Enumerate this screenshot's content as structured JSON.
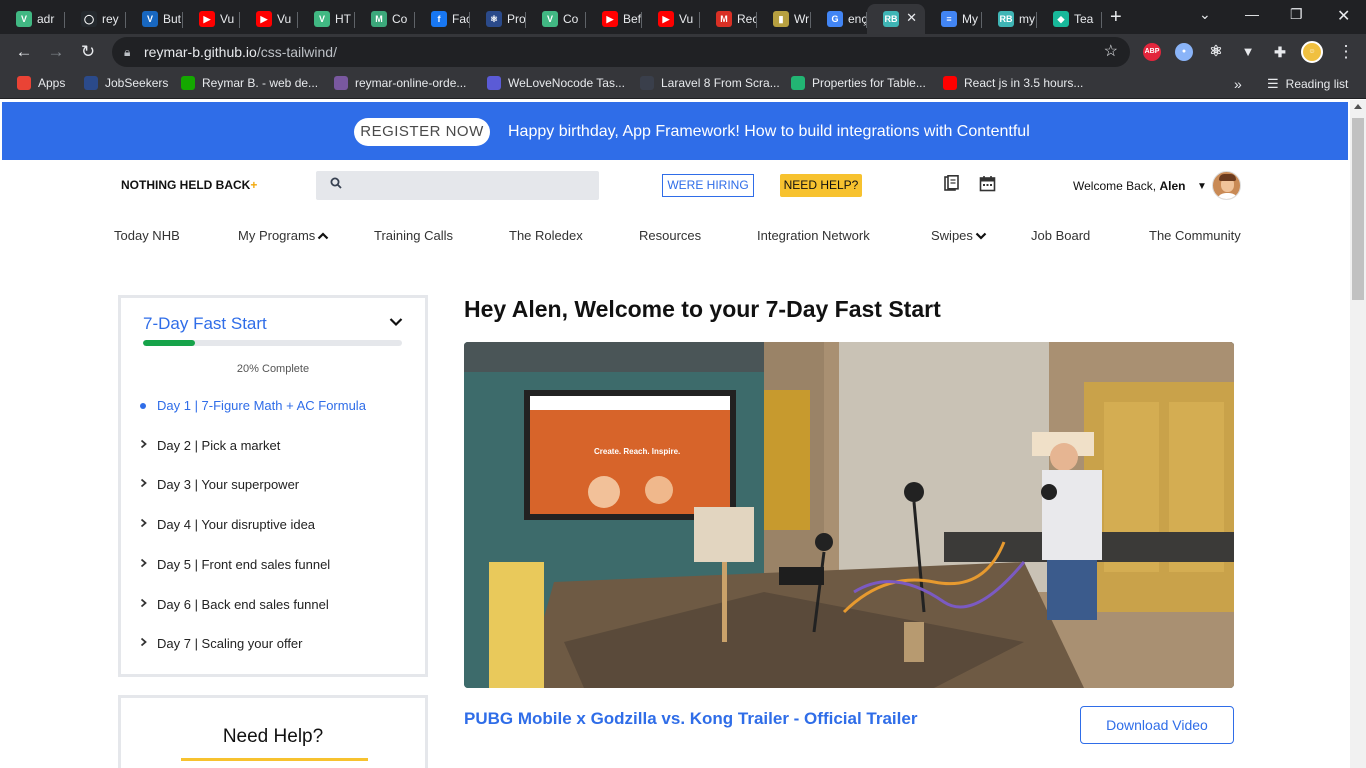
{
  "browser": {
    "tabs": [
      {
        "title": "adr",
        "favicon": "vue-icon",
        "color": "#41b883",
        "glyph": "V"
      },
      {
        "title": "rey",
        "favicon": "github-icon",
        "color": "#24292e",
        "glyph": "◯"
      },
      {
        "title": "But",
        "favicon": "vuetify-icon",
        "color": "#1867c0",
        "glyph": "V"
      },
      {
        "title": "Vu",
        "favicon": "youtube-icon",
        "color": "#ff0000",
        "glyph": "▶"
      },
      {
        "title": "Vu",
        "favicon": "youtube-icon",
        "color": "#ff0000",
        "glyph": "▶"
      },
      {
        "title": "HT",
        "favicon": "vue-icon",
        "color": "#41b883",
        "glyph": "V"
      },
      {
        "title": "Co",
        "favicon": "mdn-icon",
        "color": "#3ca87b",
        "glyph": "M"
      },
      {
        "title": "Fac",
        "favicon": "facebook-icon",
        "color": "#1877f2",
        "glyph": "f"
      },
      {
        "title": "Pro",
        "favicon": "react-icon",
        "color": "#2b4a8a",
        "glyph": "⚛"
      },
      {
        "title": "Co",
        "favicon": "vue-icon",
        "color": "#41b883",
        "glyph": "V"
      },
      {
        "title": "Bef",
        "favicon": "youtube-icon",
        "color": "#ff0000",
        "glyph": "▶"
      },
      {
        "title": "Vu",
        "favicon": "youtube-icon",
        "color": "#ff0000",
        "glyph": "▶"
      },
      {
        "title": "Rec",
        "favicon": "gmail-icon",
        "color": "#d93025",
        "glyph": "M"
      },
      {
        "title": "Wr",
        "favicon": "writing-icon",
        "color": "#b7a040",
        "glyph": "▮"
      },
      {
        "title": "enç",
        "favicon": "google-icon",
        "color": "#4285f4",
        "glyph": "G"
      },
      {
        "title": "",
        "favicon": "rb-icon",
        "color": "#3fb5b5",
        "glyph": "RB",
        "active": true
      },
      {
        "title": "My",
        "favicon": "docs-icon",
        "color": "#4285f4",
        "glyph": "≡"
      },
      {
        "title": "my",
        "favicon": "rb-icon",
        "color": "#3fb5b5",
        "glyph": "RB"
      },
      {
        "title": "Tea",
        "favicon": "diamond-icon",
        "color": "#18b89a",
        "glyph": "◆"
      }
    ],
    "url_host": "reymar-b.github.io",
    "url_path": "/css-tailwind/",
    "bookmarks": [
      {
        "label": "Apps",
        "icon": "apps-grid-icon",
        "color": "#ea4335"
      },
      {
        "label": "JobSeekers",
        "icon": "jobseekers-icon",
        "color": "#2b4a8a"
      },
      {
        "label": "Reymar B. - web de...",
        "icon": "upwork-icon",
        "color": "#14a800"
      },
      {
        "label": "reymar-online-orde...",
        "icon": "heroku-icon",
        "color": "#79589f"
      },
      {
        "label": "WeLoveNocode Tas...",
        "icon": "tasks-icon",
        "color": "#5b5bd6"
      },
      {
        "label": "Laravel 8 From Scra...",
        "icon": "laracasts-icon",
        "color": "#3a3f4b"
      },
      {
        "label": "Properties for Table...",
        "icon": "tailwind-icon",
        "color": "#22b573"
      },
      {
        "label": "React js in 3.5 hours...",
        "icon": "youtube-icon",
        "color": "#ff0000"
      }
    ],
    "reading_list": "Reading list"
  },
  "banner": {
    "button": "REGISTER NOW",
    "message": "Happy birthday, App Framework! How to build integrations with Contentful"
  },
  "header": {
    "logo": "NOTHING HELD BACK",
    "logo_plus": "+",
    "hiring": "WERE HIRING",
    "help": "NEED HELP?",
    "welcome": "Welcome Back,",
    "user": "Alen"
  },
  "nav": [
    {
      "label": "Today NHB"
    },
    {
      "label": "My Programs",
      "chevron": "up"
    },
    {
      "label": "Training Calls"
    },
    {
      "label": "The Roledex"
    },
    {
      "label": "Resources"
    },
    {
      "label": "Integration Network"
    },
    {
      "label": "Swipes",
      "chevron": "down"
    },
    {
      "label": "Job Board"
    },
    {
      "label": "The Community"
    }
  ],
  "course": {
    "title": "7-Day Fast Start",
    "progress": 0.2,
    "progress_label": "20% Complete",
    "lessons": [
      {
        "label": "Day 1 | 7-Figure Math + AC Formula",
        "active": true
      },
      {
        "label": "Day 2 | Pick a market"
      },
      {
        "label": "Day 3 | Your superpower"
      },
      {
        "label": "Day 4 | Your disruptive idea"
      },
      {
        "label": "Day 5 | Front end sales funnel"
      },
      {
        "label": "Day 6 | Back end sales funnel"
      },
      {
        "label": "Day 7 | Scaling your offer"
      }
    ]
  },
  "help_box": {
    "title": "Need Help?"
  },
  "main": {
    "heading": "Hey Alen, Welcome to your 7-Day Fast Start",
    "video_title": "PUBG Mobile x Godzilla vs. Kong Trailer - Official Trailer",
    "download": "Download Video",
    "tv_text": "Create. Reach. Inspire."
  },
  "colors": {
    "accent": "#2f6de8",
    "progress": "#16a34a",
    "highlight": "#f7c22f"
  }
}
